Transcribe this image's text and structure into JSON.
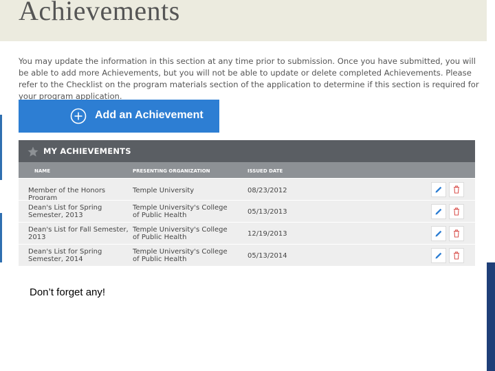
{
  "page": {
    "title": "Achievements",
    "intro": "You may update the information in this section at any time prior to submission. Once you have submitted, you will be able to add more Achievements, but you will not be able to update or delete completed Achievements. Please refer to the Checklist on the program materials section of the application to determine if this section is required for your program application."
  },
  "add_button": {
    "label": "Add an Achievement",
    "icon": "plus-circle-icon"
  },
  "panel": {
    "title": "MY ACHIEVEMENTS",
    "icon": "star-icon",
    "columns": [
      "NAME",
      "PRESENTING ORGANIZATION",
      "ISSUED DATE"
    ],
    "rows": [
      {
        "name": "Member of the Honors Program",
        "org": "Temple University",
        "date": "08/23/2012"
      },
      {
        "name": "Dean's List for Spring Semester, 2013",
        "org": "Temple University's College of Public Health",
        "date": "05/13/2013"
      },
      {
        "name": "Dean's List for Fall Semester, 2013",
        "org": "Temple University's College of Public Health",
        "date": "12/19/2013"
      },
      {
        "name": "Dean's List for Spring Semester, 2014",
        "org": "Temple University's College of Public Health",
        "date": "05/13/2014"
      }
    ],
    "actions": {
      "edit_icon": "pencil-icon",
      "delete_icon": "trash-icon"
    }
  },
  "note": "Don’t forget any!",
  "colors": {
    "accent_blue": "#2d7ed3",
    "header_band": "#ecebdf",
    "panel_header": "#5a5e63",
    "column_header": "#8d9195",
    "delete_red": "#d9534f",
    "slide_bar": "#1f3f78"
  }
}
